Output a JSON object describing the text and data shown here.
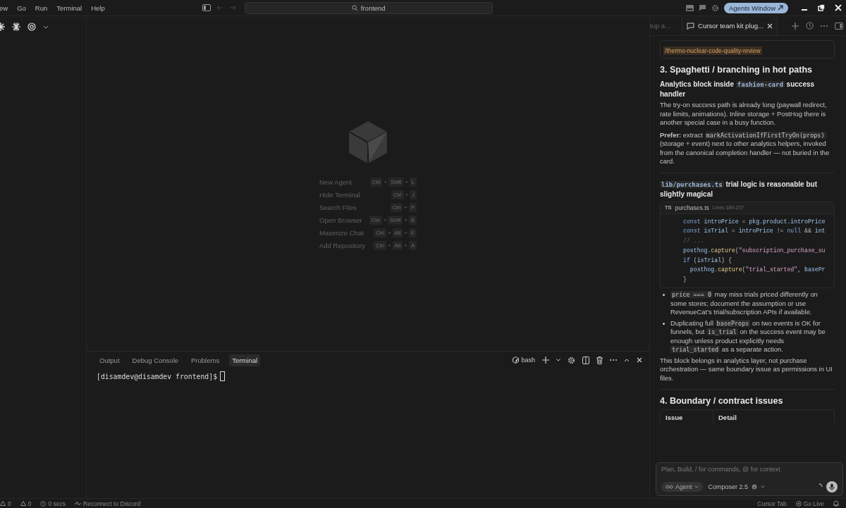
{
  "menu": [
    "ew",
    "Go",
    "Run",
    "Terminal",
    "Help"
  ],
  "search": {
    "value": "frontend"
  },
  "agents_button": {
    "label": "Agents Window"
  },
  "shortcuts": {
    "joiner": "+",
    "items": [
      {
        "label": "New Agent",
        "keys": [
          "Ctrl",
          "Shift",
          "L"
        ]
      },
      {
        "label": "Hide Terminal",
        "keys": [
          "Ctrl",
          "J"
        ]
      },
      {
        "label": "Search Files",
        "keys": [
          "Ctrl",
          "P"
        ]
      },
      {
        "label": "Open Browser",
        "keys": [
          "Ctrl",
          "Shift",
          "B"
        ]
      },
      {
        "label": "Maximize Chat",
        "keys": [
          "Ctrl",
          "Alt",
          "E"
        ]
      },
      {
        "label": "Add Repository",
        "keys": [
          "Ctrl",
          "Alt",
          "A"
        ]
      }
    ]
  },
  "panel": {
    "tabs": [
      {
        "label": "Output",
        "selected": false
      },
      {
        "label": "Debug Console",
        "selected": false
      },
      {
        "label": "Problems",
        "selected": false
      },
      {
        "label": "Terminal",
        "selected": true
      }
    ],
    "shell": "bash",
    "prompt": "[disamdev@disamdev frontend]$"
  },
  "chat": {
    "tabs": [
      {
        "label": "tup a...",
        "selected": false
      },
      {
        "label": "Cursor team kit plug...",
        "selected": true
      }
    ],
    "command": "/thermo-nuclear-code-quality-review",
    "blocks": [
      {
        "kind": "h2",
        "segs": [
          {
            "text": "3. Spaghetti / branching in hot paths",
            "kind": "plain"
          }
        ]
      },
      {
        "kind": "h3",
        "segs": [
          {
            "text": "Analytics block inside ",
            "kind": "plain"
          },
          {
            "text": "fashion-card",
            "kind": "code"
          },
          {
            "text": " success handler",
            "kind": "plain"
          }
        ]
      },
      {
        "kind": "p",
        "segs": [
          {
            "text": "The try-on success path is already long (paywall redirect, rate limits, animations). Inline storage + PostHog there is another special case in a busy function.",
            "kind": "plain"
          }
        ]
      },
      {
        "kind": "p",
        "segs": [
          {
            "text": "Prefer:",
            "kind": "bold"
          },
          {
            "text": " extract ",
            "kind": "plain"
          },
          {
            "text": "markActivationIfFirstTryOn(props)",
            "kind": "code"
          },
          {
            "text": " (storage + event) next to other analytics helpers, invoked from the canonical completion handler — not buried in the card.",
            "kind": "plain"
          }
        ]
      },
      {
        "kind": "rule"
      },
      {
        "kind": "h3",
        "segs": [
          {
            "text": "lib/purchases.ts",
            "kind": "code"
          },
          {
            "text": " trial logic is reasonable but slightly magical",
            "kind": "plain"
          }
        ]
      },
      {
        "kind": "code",
        "badge": "TS",
        "file": "purchases.ts",
        "range": "Lines 189-207",
        "lines": [
          [
            {
              "text": "const",
              "kind": "kw"
            },
            {
              "text": " introPrice",
              "kind": "id"
            },
            {
              "text": " =",
              "kind": "op"
            },
            {
              "text": " pkg.product.introPrice",
              "kind": "id"
            }
          ],
          [
            {
              "text": "const",
              "kind": "kw"
            },
            {
              "text": " isTrial",
              "kind": "id"
            },
            {
              "text": " =",
              "kind": "op"
            },
            {
              "text": " introPrice",
              "kind": "id"
            },
            {
              "text": " !=",
              "kind": "op"
            },
            {
              "text": " null",
              "kind": "kw"
            },
            {
              "text": " &&",
              "kind": "op"
            },
            {
              "text": " int",
              "kind": "id"
            }
          ],
          [
            {
              "text": "// ...",
              "kind": "cmt"
            }
          ],
          [
            {
              "text": "posthog",
              "kind": "id"
            },
            {
              "text": ".",
              "kind": "op"
            },
            {
              "text": "capture",
              "kind": "fn"
            },
            {
              "text": "(",
              "kind": "op"
            },
            {
              "text": "\"subscription_purchase_su",
              "kind": "str"
            }
          ],
          [
            {
              "text": "if",
              "kind": "kw"
            },
            {
              "text": " (",
              "kind": "op"
            },
            {
              "text": "isTrial",
              "kind": "id"
            },
            {
              "text": ") {",
              "kind": "op"
            }
          ],
          [
            {
              "text": "  posthog",
              "kind": "id"
            },
            {
              "text": ".",
              "kind": "op"
            },
            {
              "text": "capture",
              "kind": "fn"
            },
            {
              "text": "(",
              "kind": "op"
            },
            {
              "text": "\"trial_started\"",
              "kind": "str"
            },
            {
              "text": ", ",
              "kind": "op"
            },
            {
              "text": "basePr",
              "kind": "id"
            }
          ],
          [
            {
              "text": "}",
              "kind": "op"
            }
          ]
        ]
      },
      {
        "kind": "list",
        "items": [
          [
            {
              "text": "price === 0",
              "kind": "code"
            },
            {
              "text": " may miss trials priced differently on some stores; document the assumption or use RevenueCat’s trial/subscription APIs if available.",
              "kind": "plain"
            }
          ],
          [
            {
              "text": "Duplicating full ",
              "kind": "plain"
            },
            {
              "text": "baseProps",
              "kind": "code"
            },
            {
              "text": " on two events is OK for funnels, but ",
              "kind": "plain"
            },
            {
              "text": "is_trial",
              "kind": "code"
            },
            {
              "text": " on the success event may be enough unless product explicitly needs ",
              "kind": "plain"
            },
            {
              "text": "trial_started",
              "kind": "code"
            },
            {
              "text": " as a separate action.",
              "kind": "plain"
            }
          ]
        ]
      },
      {
        "kind": "p",
        "segs": [
          {
            "text": "This block belongs in analytics layer, not purchase orchestration — same boundary issue as permissions in UI files.",
            "kind": "plain"
          }
        ]
      },
      {
        "kind": "rule"
      },
      {
        "kind": "h2",
        "segs": [
          {
            "text": "4. Boundary / contract issues",
            "kind": "plain"
          }
        ]
      },
      {
        "kind": "table",
        "columns": [
          "Issue",
          "Detail"
        ]
      }
    ],
    "input": {
      "placeholder": "Plan, Build, / for commands, @ for context",
      "mode": "Agent",
      "model": "Composer 2.5"
    }
  },
  "status": {
    "errors": "0",
    "warnings": "0",
    "time": "0 secs",
    "discord": "Reconnect to Discord",
    "right": [
      "Cursor Tab",
      "Go Live"
    ]
  }
}
